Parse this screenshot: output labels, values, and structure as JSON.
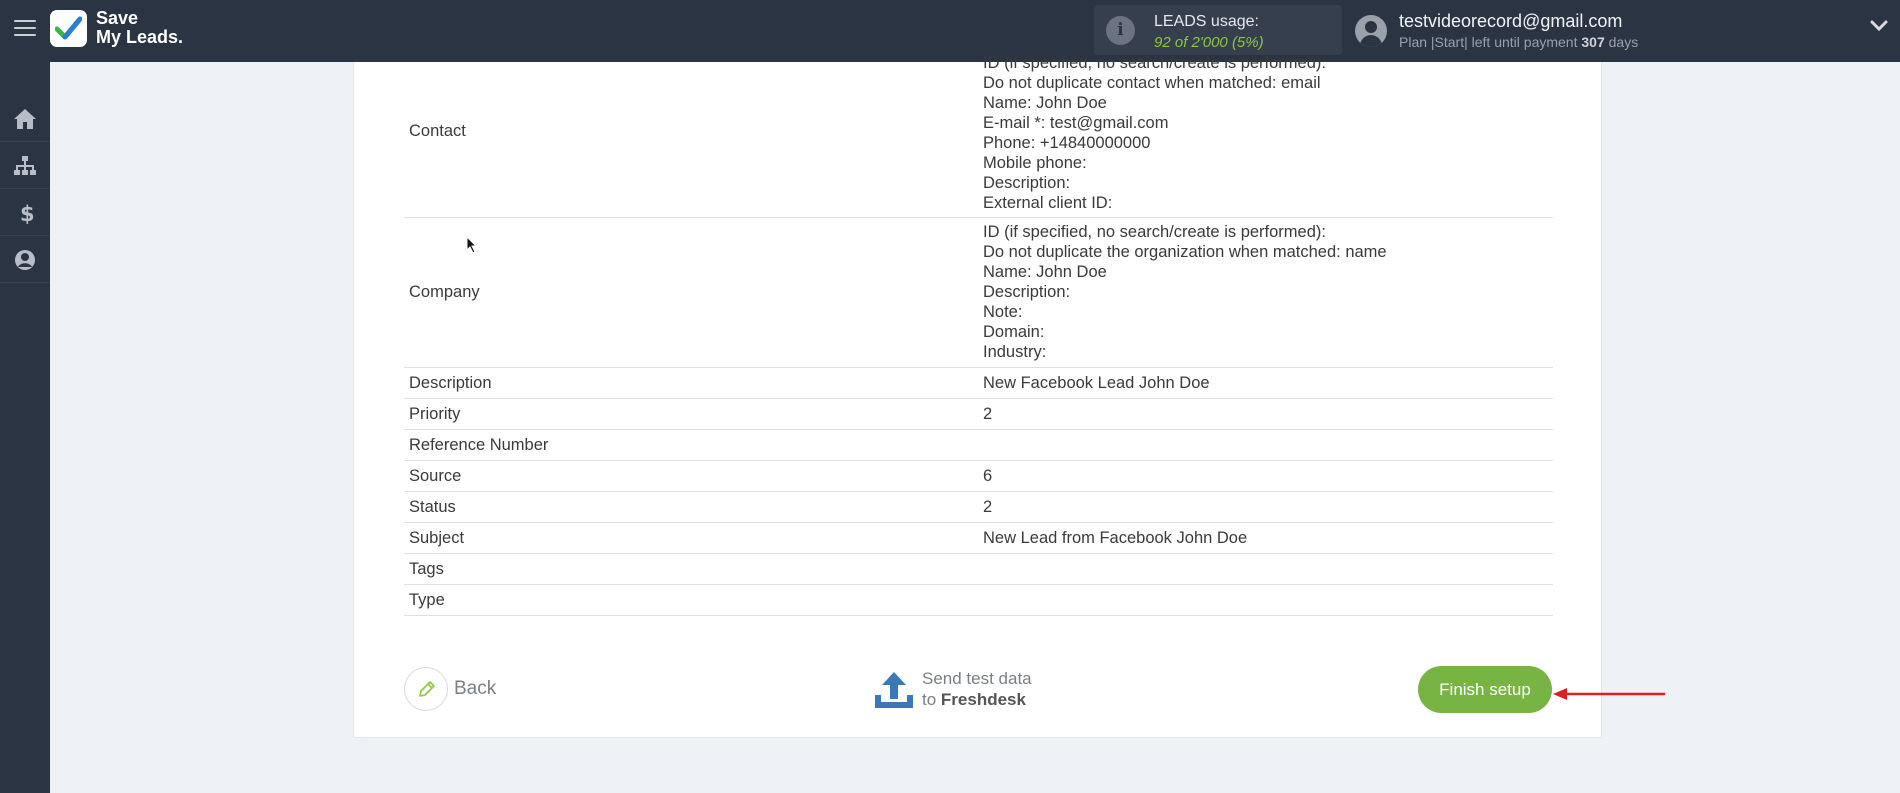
{
  "brand": {
    "name_line1": "Save",
    "name_line2": "My Leads."
  },
  "usage": {
    "label": "LEADS usage:",
    "value": "92 of 2'000",
    "percent": "(5%)"
  },
  "user": {
    "email": "testvideorecord@gmail.com",
    "plan_prefix": "Plan |Start| left until payment ",
    "days": "307",
    "days_suffix": " days"
  },
  "sidebar": {
    "items": [
      {
        "name": "home-icon"
      },
      {
        "name": "sitemap-icon"
      },
      {
        "name": "dollar-icon"
      },
      {
        "name": "account-icon"
      }
    ]
  },
  "table": {
    "contact": {
      "key": "Contact",
      "lines": [
        "ID (if specified, no search/create is performed):",
        "Do not duplicate contact when matched: email",
        "Name: John Doe",
        "E-mail *: test@gmail.com",
        "Phone: +14840000000",
        "Mobile phone:",
        "Description:",
        "External client ID:"
      ]
    },
    "company": {
      "key": "Company",
      "lines": [
        "ID (if specified, no search/create is performed):",
        "Do not duplicate the organization when matched: name",
        "Name: John Doe",
        "Description:",
        "Note:",
        "Domain:",
        "Industry:"
      ]
    },
    "rows": [
      {
        "key": "Description",
        "value": "New Facebook Lead John Doe"
      },
      {
        "key": "Priority",
        "value": "2"
      },
      {
        "key": "Reference Number",
        "value": ""
      },
      {
        "key": "Source",
        "value": "6"
      },
      {
        "key": "Status",
        "value": "2"
      },
      {
        "key": "Subject",
        "value": "New Lead from Facebook John Doe"
      },
      {
        "key": "Tags",
        "value": ""
      },
      {
        "key": "Type",
        "value": ""
      }
    ]
  },
  "actions": {
    "back_label": "Back",
    "send_line1": "Send test data",
    "send_line2_prefix": "to ",
    "send_line2_target": "Freshdesk",
    "finish_label": "Finish setup"
  },
  "colors": {
    "topbar": "#2b3443",
    "accent_green": "#78b443",
    "usage_green": "#8dc63f",
    "arrow_red": "#e02020"
  }
}
